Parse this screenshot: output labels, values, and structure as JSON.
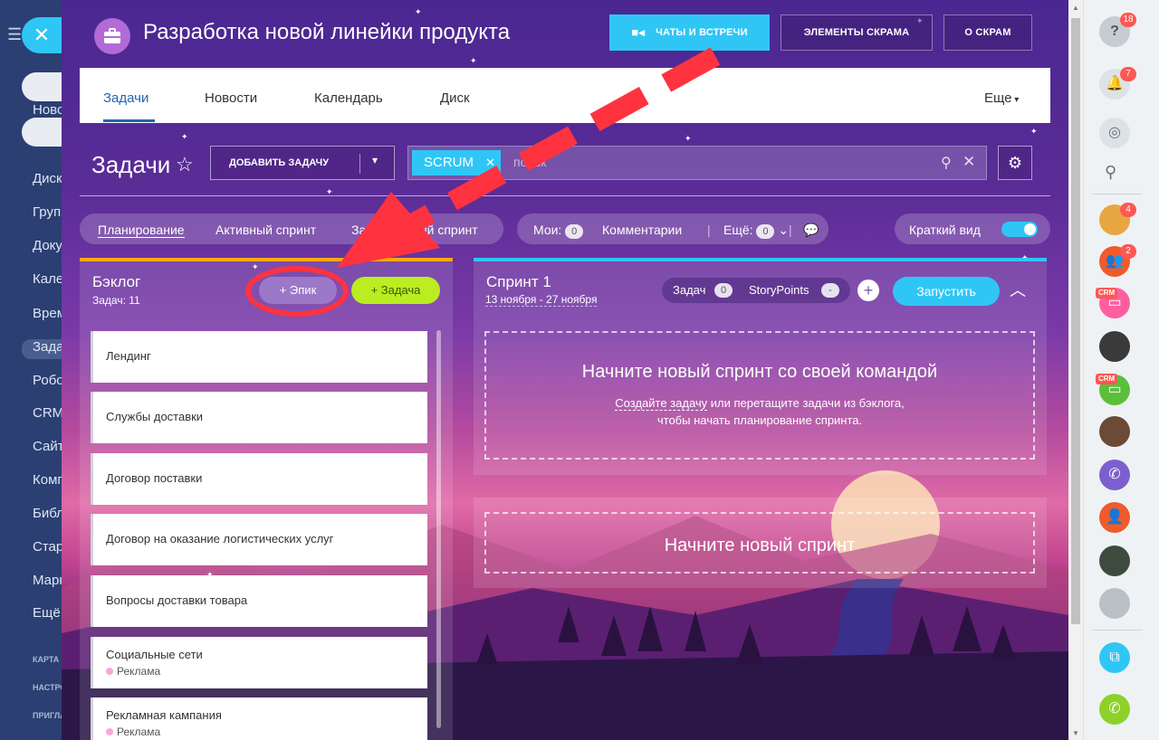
{
  "sidebar_left": {
    "items": [
      "Новости",
      "Диск",
      "Группы",
      "Документы",
      "Календарь",
      "Время",
      "Задачи",
      "Роботы",
      "CRM",
      "Сайты",
      "Компания",
      "Библиотека",
      "Старт",
      "Маркет",
      "Ещё"
    ],
    "sections": [
      "КАРТА",
      "НАСТРОЙКИ",
      "ПРИГЛАСИТЬ"
    ]
  },
  "header": {
    "title": "Разработка новой линейки продукта",
    "chats_label": "ЧАТЫ И ВСТРЕЧИ",
    "elements_label": "ЭЛЕМЕНТЫ СКРАМА",
    "about_label": "О СКРАМ"
  },
  "tabs": {
    "items": [
      "Задачи",
      "Новости",
      "Календарь",
      "Диск"
    ],
    "more": "Еще"
  },
  "toolbar": {
    "title": "Задачи",
    "add_task": "ДОБАВИТЬ ЗАДАЧУ",
    "filter_tag": "SCRUM",
    "search_placeholder": "поиск"
  },
  "filters": {
    "planning": "Планирование",
    "active_sprint": "Активный спринт",
    "completed_sprint": "Завершенный спринт",
    "mine": "Мои:",
    "mine_count": "0",
    "comments": "Комментарии",
    "more": "Ещё:",
    "more_count": "0",
    "brief_view": "Краткий вид"
  },
  "backlog": {
    "title": "Бэклог",
    "count": "Задач: 11",
    "epic_btn": "+ Эпик",
    "task_btn": "+ Задача",
    "items": [
      {
        "title": "Лендинг",
        "tag": ""
      },
      {
        "title": "Службы доставки",
        "tag": ""
      },
      {
        "title": "Договор поставки",
        "tag": ""
      },
      {
        "title": "Договор на оказание логистических услуг",
        "tag": ""
      },
      {
        "title": "Вопросы доставки товара",
        "tag": ""
      },
      {
        "title": "Социальные сети",
        "tag": "Реклама"
      },
      {
        "title": "Рекламная кампания",
        "tag": "Реклама"
      }
    ]
  },
  "sprint": {
    "title": "Спринт 1",
    "dates": "13 ноября - 27 ноября",
    "tasks_label": "Задач",
    "tasks_count": "0",
    "sp_label": "StoryPoints",
    "sp_value": "-",
    "start_btn": "Запустить",
    "empty_title": "Начните новый спринт со своей командой",
    "empty_link": "Создайте задачу",
    "empty_rest": " или перетащите задачи из бэклога,",
    "empty_line2": "чтобы начать планирование спринта."
  },
  "new_sprint": {
    "label": "Начните новый спринт"
  },
  "right_bar": {
    "help_badge": "18",
    "notif_badge": "7",
    "avatar1_badge": "4",
    "group_badge": "2",
    "crm_label": "CRM"
  },
  "colors": {
    "accent": "#2fc6f6",
    "annotation": "#ff3340",
    "task_green": "#bbed21"
  }
}
